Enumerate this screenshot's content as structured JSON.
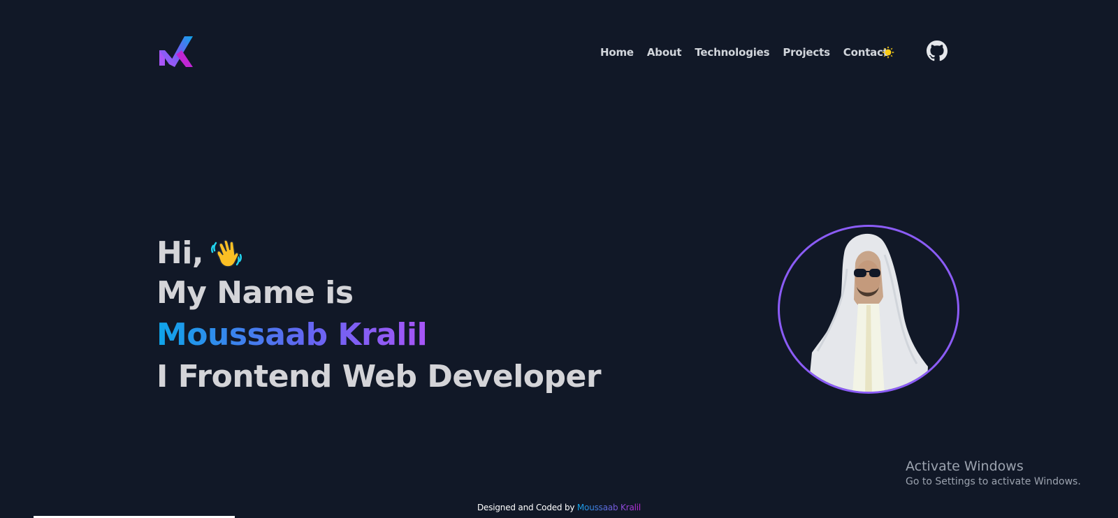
{
  "header": {
    "logo_icon": "mk-logo-icon",
    "nav": [
      {
        "label": "Home"
      },
      {
        "label": "About"
      },
      {
        "label": "Technologies"
      },
      {
        "label": "Projects"
      },
      {
        "label": "Contact"
      }
    ],
    "theme_toggle_icon": "sun-icon",
    "github_icon": "github-icon"
  },
  "hero": {
    "greeting": "Hi,",
    "greeting_icon": "waving-hand-icon",
    "intro": "My Name is",
    "name": "Moussaab Kralil",
    "role": "I Frontend Web Developer",
    "avatar_icon": "profile-photo"
  },
  "watermark": {
    "title": "Activate Windows",
    "subtitle": "Go to Settings to activate Windows."
  },
  "footer": {
    "prefix": "Designed and Coded by",
    "author": "Moussaab Kralil"
  },
  "scroll_progress": 0.18,
  "colors": {
    "background": "#111827",
    "text": "#d4d4d8",
    "accent_purple": "#8b5cf6",
    "accent_blue": "#0ea5e9",
    "sun": "#facc15"
  }
}
